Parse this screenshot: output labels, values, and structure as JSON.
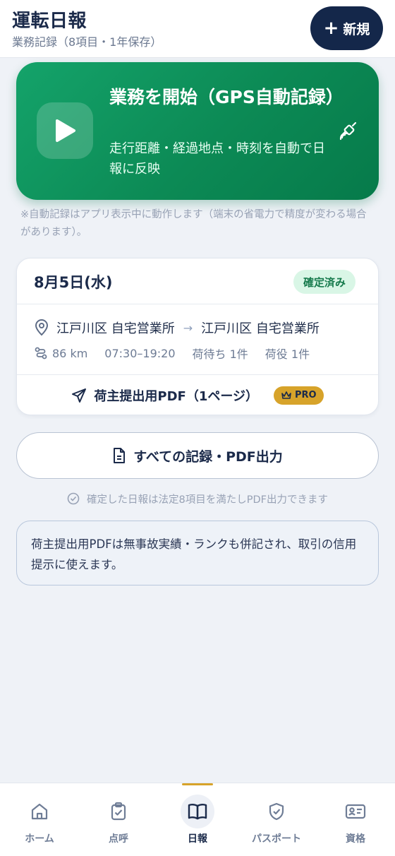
{
  "header": {
    "title": "運転日報",
    "subtitle": "業務記録（8項目・1年保存）",
    "new_button": {
      "icon": "plus-icon",
      "label": "新規"
    }
  },
  "start_banner": {
    "title": "業務を開始（GPS自動記録）",
    "description": "走行距離・経過地点・時刻を自動で日報に反映",
    "play_icon": "play-icon",
    "side_icon": "satellite-icon"
  },
  "auto_record_note": "※自動記録はアプリ表示中に動作します（端末の省電力で精度が変わる場合があります）。",
  "record_card": {
    "date": "8月5日(水)",
    "status": "確定済み",
    "route": {
      "from": "江戸川区 自宅営業所",
      "arrow": "→",
      "to": "江戸川区 自宅営業所"
    },
    "meta": {
      "distance": "86 km",
      "time_range": "07:30–19:20",
      "waiting": "荷待ち 1件",
      "handling": "荷役 1件"
    },
    "pdf_label": "荷主提出用PDF（1ページ）",
    "pro_badge": "PRO"
  },
  "all_records_button": "すべての記録・PDF出力",
  "compliance_note": "確定した日報は法定8項目を満たしPDF出力できます",
  "info_box": "荷主提出用PDFは無事故実績・ランクも併記され、取引の信用提示に使えます。",
  "bottom_nav": {
    "items": [
      {
        "label": "ホーム",
        "icon": "home-icon",
        "active": false
      },
      {
        "label": "点呼",
        "icon": "clipboard-check-icon",
        "active": false
      },
      {
        "label": "日報",
        "icon": "book-open-icon",
        "active": true
      },
      {
        "label": "パスポート",
        "icon": "shield-check-icon",
        "active": false
      },
      {
        "label": "資格",
        "icon": "id-card-icon",
        "active": false
      }
    ]
  },
  "colors": {
    "brand_navy": "#14274a",
    "banner_green": "#0c8a55",
    "status_green_bg": "#d9f6e6",
    "pro_gold": "#d7a32a"
  }
}
